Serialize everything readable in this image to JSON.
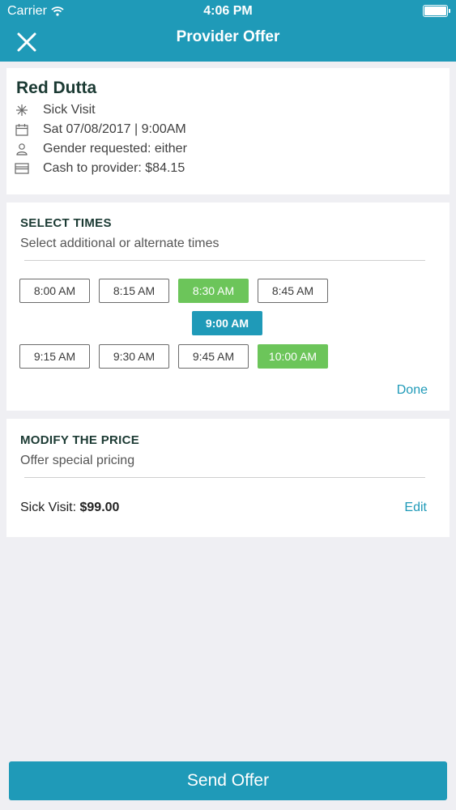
{
  "status_bar": {
    "carrier": "Carrier",
    "time": "4:06 PM"
  },
  "nav": {
    "title": "Provider Offer"
  },
  "provider": {
    "name": "Red Dutta",
    "visit_type": "Sick Visit",
    "datetime": "Sat 07/08/2017 | 9:00AM",
    "gender": "Gender requested: either",
    "cash": "Cash to provider: $84.15"
  },
  "select_times": {
    "title": "SELECT TIMES",
    "subtitle": "Select additional or alternate times",
    "times": [
      {
        "label": "8:00 AM",
        "state": "unselected"
      },
      {
        "label": "8:15 AM",
        "state": "unselected"
      },
      {
        "label": "8:30 AM",
        "state": "selected"
      },
      {
        "label": "8:45 AM",
        "state": "unselected"
      },
      {
        "label": "9:00 AM",
        "state": "requested"
      },
      {
        "label": "9:15 AM",
        "state": "unselected"
      },
      {
        "label": "9:30 AM",
        "state": "unselected"
      },
      {
        "label": "9:45 AM",
        "state": "unselected"
      },
      {
        "label": "10:00 AM",
        "state": "selected"
      }
    ],
    "done_label": "Done"
  },
  "modify_price": {
    "title": "MODIFY THE PRICE",
    "subtitle": "Offer special pricing",
    "price_label": "Sick Visit: ",
    "price_value": "$99.00",
    "edit_label": "Edit"
  },
  "send_button": "Send Offer",
  "colors": {
    "primary": "#1f9ab8",
    "selected": "#6cc55a",
    "background": "#efeff3"
  }
}
